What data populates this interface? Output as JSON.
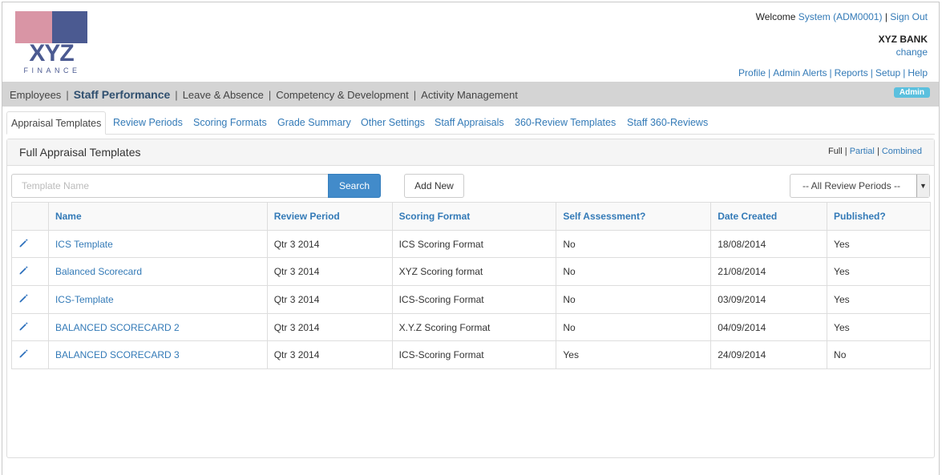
{
  "header": {
    "welcome_prefix": "Welcome",
    "user": "System (ADM0001)",
    "divider": "|",
    "sign_out": "Sign Out",
    "bank_name": "XYZ BANK",
    "change": "change",
    "top_links": [
      "Profile",
      "Admin Alerts",
      "Reports",
      "Setup",
      "Help"
    ],
    "logo_text": "XYZ",
    "logo_sub": "FINANCE"
  },
  "nav": {
    "items": [
      "Employees",
      "Staff Performance",
      "Leave & Absence",
      "Competency & Development",
      "Activity Management"
    ],
    "active": "Staff Performance",
    "badge": "Admin"
  },
  "tabs": [
    "Appraisal Templates",
    "Review Periods",
    "Scoring Formats",
    "Grade Summary",
    "Other Settings",
    "Staff Appraisals",
    "360-Review Templates",
    "Staff 360-Reviews"
  ],
  "panel": {
    "title": "Full Appraisal Templates",
    "view_full": "Full",
    "view_partial": "Partial",
    "view_combined": "Combined",
    "search_placeholder": "Template Name",
    "search_label": "Search",
    "add_label": "Add New",
    "period_select": "-- All Review Periods --"
  },
  "table": {
    "columns": [
      "Name",
      "Review Period",
      "Scoring Format",
      "Self Assessment?",
      "Date Created",
      "Published?"
    ],
    "rows": [
      [
        "ICS Template",
        "Qtr 3 2014",
        "ICS Scoring Format",
        "No",
        "18/08/2014",
        "Yes"
      ],
      [
        "Balanced Scorecard",
        "Qtr 3 2014",
        "XYZ Scoring format",
        "No",
        "21/08/2014",
        "Yes"
      ],
      [
        "ICS-Template",
        "Qtr 3 2014",
        "ICS-Scoring Format",
        "No",
        "03/09/2014",
        "Yes"
      ],
      [
        "BALANCED SCORECARD 2",
        "Qtr 3 2014",
        "X.Y.Z Scoring Format",
        "No",
        "04/09/2014",
        "Yes"
      ],
      [
        "BALANCED SCORECARD 3",
        "Qtr 3 2014",
        "ICS-Scoring Format",
        "Yes",
        "24/09/2014",
        "No"
      ]
    ]
  },
  "colors": {
    "link": "#337ab7",
    "logo_pink": "#d995a5",
    "logo_blue": "#4b5a91",
    "badge": "#5bc0de",
    "primary_button": "#428bca"
  }
}
